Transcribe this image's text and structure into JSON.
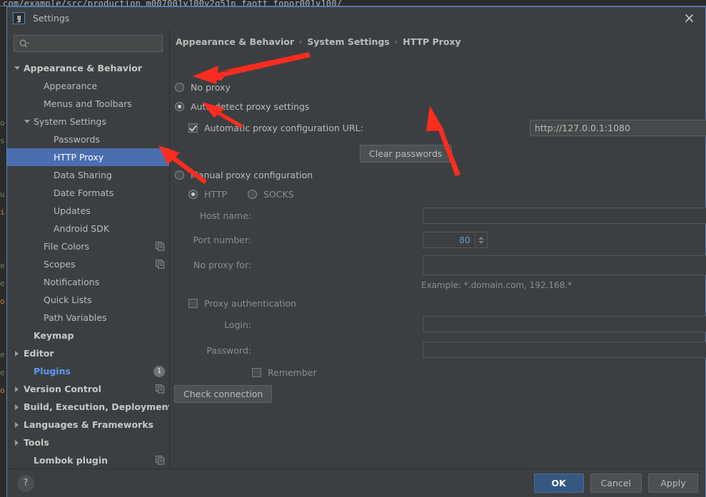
{
  "background": {
    "top_code_line": "com/example/src/production_m007001v100v2q51p_faott_fopor001v100/",
    "gutter_glyphs": [
      "",
      "",
      "",
      "",
      "",
      "",
      "",
      "o",
      "s",
      "",
      "",
      "u",
      "i",
      "",
      "",
      "e",
      "e",
      "o",
      "",
      "",
      "",
      "",
      "e",
      "e",
      "o",
      "",
      ""
    ]
  },
  "titlebar": {
    "logo": "intellij-idea-logo",
    "logo_text": "IJ",
    "title": "Settings",
    "close_label": "close-icon"
  },
  "sidebar": {
    "search": {
      "placeholder": "",
      "value": "",
      "icon": "search-icon"
    },
    "items": [
      {
        "label": "Appearance & Behavior",
        "indent": 8,
        "twisty": "down",
        "bold": true,
        "selected": false,
        "icon": null
      },
      {
        "label": "Appearance",
        "indent": 36,
        "twisty": "none",
        "bold": false,
        "selected": false,
        "icon": null
      },
      {
        "label": "Menus and Toolbars",
        "indent": 36,
        "twisty": "none",
        "bold": false,
        "selected": false,
        "icon": null
      },
      {
        "label": "System Settings",
        "indent": 22,
        "twisty": "down",
        "bold": false,
        "selected": false,
        "icon": null
      },
      {
        "label": "Passwords",
        "indent": 50,
        "twisty": "none",
        "bold": false,
        "selected": false,
        "icon": null
      },
      {
        "label": "HTTP Proxy",
        "indent": 50,
        "twisty": "none",
        "bold": false,
        "selected": true,
        "icon": null
      },
      {
        "label": "Data Sharing",
        "indent": 50,
        "twisty": "none",
        "bold": false,
        "selected": false,
        "icon": null
      },
      {
        "label": "Date Formats",
        "indent": 50,
        "twisty": "none",
        "bold": false,
        "selected": false,
        "icon": null
      },
      {
        "label": "Updates",
        "indent": 50,
        "twisty": "none",
        "bold": false,
        "selected": false,
        "icon": null
      },
      {
        "label": "Android SDK",
        "indent": 50,
        "twisty": "none",
        "bold": false,
        "selected": false,
        "icon": null
      },
      {
        "label": "File Colors",
        "indent": 36,
        "twisty": "none",
        "bold": false,
        "selected": false,
        "icon": "copy-icon"
      },
      {
        "label": "Scopes",
        "indent": 36,
        "twisty": "none",
        "bold": false,
        "selected": false,
        "icon": "copy-icon"
      },
      {
        "label": "Notifications",
        "indent": 36,
        "twisty": "none",
        "bold": false,
        "selected": false,
        "icon": null
      },
      {
        "label": "Quick Lists",
        "indent": 36,
        "twisty": "none",
        "bold": false,
        "selected": false,
        "icon": null
      },
      {
        "label": "Path Variables",
        "indent": 36,
        "twisty": "none",
        "bold": false,
        "selected": false,
        "icon": null
      },
      {
        "label": "Keymap",
        "indent": 22,
        "twisty": "none",
        "bold": true,
        "selected": false,
        "icon": null
      },
      {
        "label": "Editor",
        "indent": 8,
        "twisty": "right",
        "bold": true,
        "selected": false,
        "icon": null
      },
      {
        "label": "Plugins",
        "indent": 22,
        "twisty": "none",
        "bold": true,
        "selected": false,
        "icon": null,
        "accent": "plugins",
        "badge": "1"
      },
      {
        "label": "Version Control",
        "indent": 8,
        "twisty": "right",
        "bold": true,
        "selected": false,
        "icon": "copy-icon"
      },
      {
        "label": "Build, Execution, Deployment",
        "indent": 8,
        "twisty": "right",
        "bold": true,
        "selected": false,
        "icon": null
      },
      {
        "label": "Languages & Frameworks",
        "indent": 8,
        "twisty": "right",
        "bold": true,
        "selected": false,
        "icon": null
      },
      {
        "label": "Tools",
        "indent": 8,
        "twisty": "right",
        "bold": true,
        "selected": false,
        "icon": null
      },
      {
        "label": "Lombok plugin",
        "indent": 22,
        "twisty": "none",
        "bold": true,
        "selected": false,
        "icon": "copy-icon"
      }
    ]
  },
  "main": {
    "breadcrumb": {
      "part1": "Appearance & Behavior",
      "sep1": "›",
      "part2": "System Settings",
      "sep2": "›",
      "part3": "HTTP Proxy"
    },
    "no_proxy_radio_label": "No proxy",
    "auto_detect_radio_label": "Auto-detect proxy settings",
    "auto_config_checkbox_label": "Automatic proxy configuration URL:",
    "auto_config_url_value": "http://127.0.0.1:1080",
    "clear_passwords_label": "Clear passwords",
    "manual_radio_label": "Manual proxy configuration",
    "http_radio_label": "HTTP",
    "socks_radio_label": "SOCKS",
    "host_name_label": "Host name:",
    "host_name_value": "",
    "port_number_label": "Port number:",
    "port_number_value": "80",
    "no_proxy_for_label": "No proxy for:",
    "no_proxy_for_value": "",
    "example_text": "Example: *.domain.com, 192.168.*",
    "proxy_auth_checkbox_label": "Proxy authentication",
    "login_label": "Login:",
    "login_value": "",
    "password_label": "Password:",
    "password_value": "",
    "remember_label": "Remember",
    "check_connection_label": "Check connection",
    "expand_icon": "expand-icon"
  },
  "footer": {
    "help_label": "?",
    "ok_label": "OK",
    "cancel_label": "Cancel",
    "apply_label": "Apply"
  },
  "colors": {
    "dialog_bg": "#3c3f41",
    "selection_blue": "#4b6eaf",
    "accent_link": "#589df6",
    "primary_button": "#365880",
    "annotation_red": "#fb2c20",
    "field_bg": "#45494a",
    "spinner_value": "#6897bb"
  }
}
